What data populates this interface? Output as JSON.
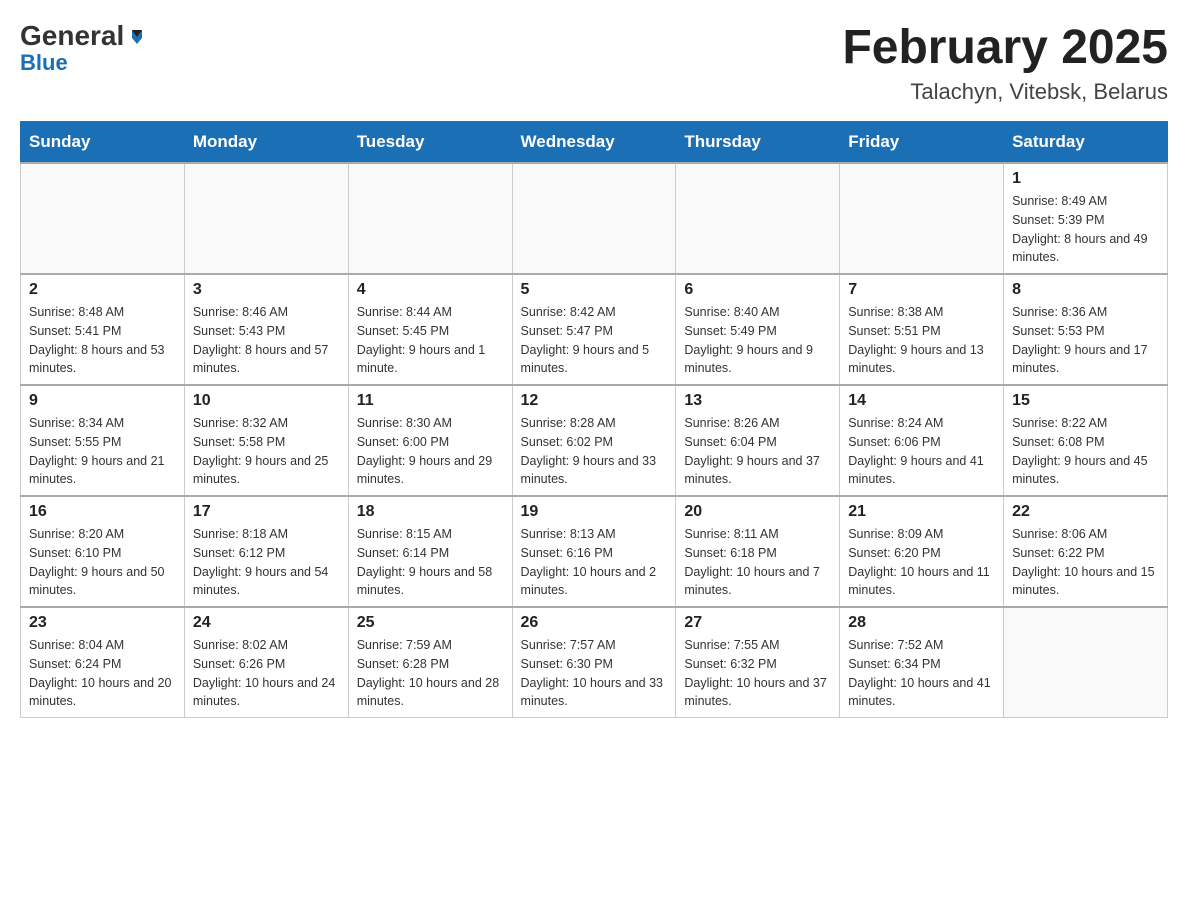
{
  "header": {
    "logo_general": "General",
    "logo_blue": "Blue",
    "title": "February 2025",
    "subtitle": "Talachyn, Vitebsk, Belarus"
  },
  "days_of_week": [
    "Sunday",
    "Monday",
    "Tuesday",
    "Wednesday",
    "Thursday",
    "Friday",
    "Saturday"
  ],
  "weeks": [
    [
      {
        "day": "",
        "info": ""
      },
      {
        "day": "",
        "info": ""
      },
      {
        "day": "",
        "info": ""
      },
      {
        "day": "",
        "info": ""
      },
      {
        "day": "",
        "info": ""
      },
      {
        "day": "",
        "info": ""
      },
      {
        "day": "1",
        "info": "Sunrise: 8:49 AM\nSunset: 5:39 PM\nDaylight: 8 hours and 49 minutes."
      }
    ],
    [
      {
        "day": "2",
        "info": "Sunrise: 8:48 AM\nSunset: 5:41 PM\nDaylight: 8 hours and 53 minutes."
      },
      {
        "day": "3",
        "info": "Sunrise: 8:46 AM\nSunset: 5:43 PM\nDaylight: 8 hours and 57 minutes."
      },
      {
        "day": "4",
        "info": "Sunrise: 8:44 AM\nSunset: 5:45 PM\nDaylight: 9 hours and 1 minute."
      },
      {
        "day": "5",
        "info": "Sunrise: 8:42 AM\nSunset: 5:47 PM\nDaylight: 9 hours and 5 minutes."
      },
      {
        "day": "6",
        "info": "Sunrise: 8:40 AM\nSunset: 5:49 PM\nDaylight: 9 hours and 9 minutes."
      },
      {
        "day": "7",
        "info": "Sunrise: 8:38 AM\nSunset: 5:51 PM\nDaylight: 9 hours and 13 minutes."
      },
      {
        "day": "8",
        "info": "Sunrise: 8:36 AM\nSunset: 5:53 PM\nDaylight: 9 hours and 17 minutes."
      }
    ],
    [
      {
        "day": "9",
        "info": "Sunrise: 8:34 AM\nSunset: 5:55 PM\nDaylight: 9 hours and 21 minutes."
      },
      {
        "day": "10",
        "info": "Sunrise: 8:32 AM\nSunset: 5:58 PM\nDaylight: 9 hours and 25 minutes."
      },
      {
        "day": "11",
        "info": "Sunrise: 8:30 AM\nSunset: 6:00 PM\nDaylight: 9 hours and 29 minutes."
      },
      {
        "day": "12",
        "info": "Sunrise: 8:28 AM\nSunset: 6:02 PM\nDaylight: 9 hours and 33 minutes."
      },
      {
        "day": "13",
        "info": "Sunrise: 8:26 AM\nSunset: 6:04 PM\nDaylight: 9 hours and 37 minutes."
      },
      {
        "day": "14",
        "info": "Sunrise: 8:24 AM\nSunset: 6:06 PM\nDaylight: 9 hours and 41 minutes."
      },
      {
        "day": "15",
        "info": "Sunrise: 8:22 AM\nSunset: 6:08 PM\nDaylight: 9 hours and 45 minutes."
      }
    ],
    [
      {
        "day": "16",
        "info": "Sunrise: 8:20 AM\nSunset: 6:10 PM\nDaylight: 9 hours and 50 minutes."
      },
      {
        "day": "17",
        "info": "Sunrise: 8:18 AM\nSunset: 6:12 PM\nDaylight: 9 hours and 54 minutes."
      },
      {
        "day": "18",
        "info": "Sunrise: 8:15 AM\nSunset: 6:14 PM\nDaylight: 9 hours and 58 minutes."
      },
      {
        "day": "19",
        "info": "Sunrise: 8:13 AM\nSunset: 6:16 PM\nDaylight: 10 hours and 2 minutes."
      },
      {
        "day": "20",
        "info": "Sunrise: 8:11 AM\nSunset: 6:18 PM\nDaylight: 10 hours and 7 minutes."
      },
      {
        "day": "21",
        "info": "Sunrise: 8:09 AM\nSunset: 6:20 PM\nDaylight: 10 hours and 11 minutes."
      },
      {
        "day": "22",
        "info": "Sunrise: 8:06 AM\nSunset: 6:22 PM\nDaylight: 10 hours and 15 minutes."
      }
    ],
    [
      {
        "day": "23",
        "info": "Sunrise: 8:04 AM\nSunset: 6:24 PM\nDaylight: 10 hours and 20 minutes."
      },
      {
        "day": "24",
        "info": "Sunrise: 8:02 AM\nSunset: 6:26 PM\nDaylight: 10 hours and 24 minutes."
      },
      {
        "day": "25",
        "info": "Sunrise: 7:59 AM\nSunset: 6:28 PM\nDaylight: 10 hours and 28 minutes."
      },
      {
        "day": "26",
        "info": "Sunrise: 7:57 AM\nSunset: 6:30 PM\nDaylight: 10 hours and 33 minutes."
      },
      {
        "day": "27",
        "info": "Sunrise: 7:55 AM\nSunset: 6:32 PM\nDaylight: 10 hours and 37 minutes."
      },
      {
        "day": "28",
        "info": "Sunrise: 7:52 AM\nSunset: 6:34 PM\nDaylight: 10 hours and 41 minutes."
      },
      {
        "day": "",
        "info": ""
      }
    ]
  ]
}
